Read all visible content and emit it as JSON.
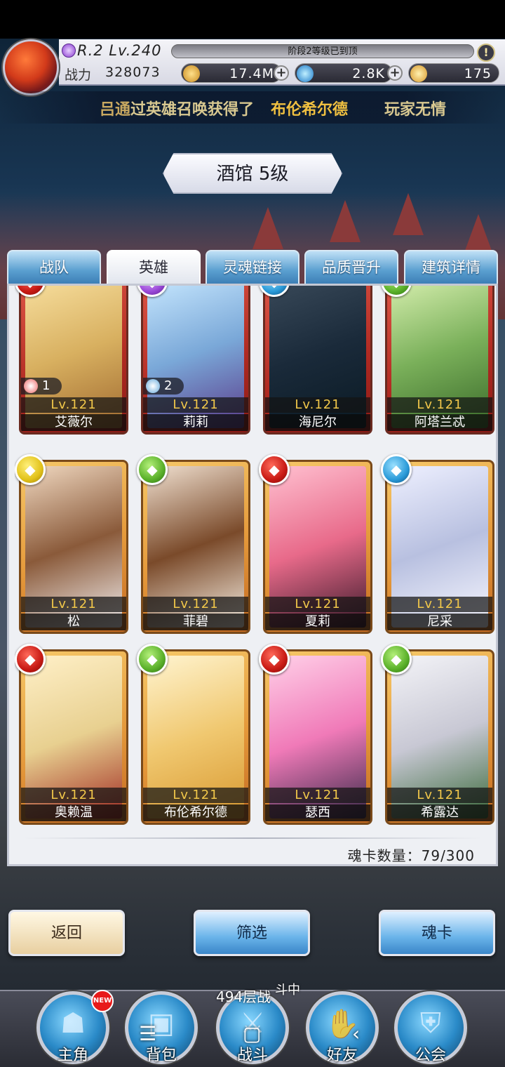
{
  "player": {
    "rank": "R.2 Lv.240",
    "stage_notice": "阶段2等级已到顶",
    "power_label": "战力",
    "power_value": "328073"
  },
  "resources": [
    {
      "icon": "gold-coin-icon",
      "value": "17.4M",
      "color": "#e0a030"
    },
    {
      "icon": "blue-gem-icon",
      "value": "2.8K",
      "color": "#2a8ad8"
    },
    {
      "icon": "gold-ticket-icon",
      "value": "175",
      "color": "#e8b040"
    }
  ],
  "marquee": {
    "part1": "过英雄召唤获得了",
    "hero": "布伦希尔德",
    "part2": "玩家无情",
    "prefix": "吕通"
  },
  "tavern": {
    "title": "酒馆 5级"
  },
  "tabs": [
    {
      "label": "战队"
    },
    {
      "label": "英雄",
      "active": true
    },
    {
      "label": "灵魂链接"
    },
    {
      "label": "品质晋升"
    },
    {
      "label": "建筑详情"
    }
  ],
  "heroes": [
    {
      "name": "艾薇尔",
      "level": "Lv.121",
      "soul": "1",
      "badge": "red",
      "frame": "red"
    },
    {
      "name": "莉莉",
      "level": "Lv.121",
      "soul": "2",
      "badge": "purple",
      "frame": "red"
    },
    {
      "name": "海尼尔",
      "level": "Lv.121",
      "badge": "blue",
      "frame": "red"
    },
    {
      "name": "阿塔兰忒",
      "level": "Lv.121",
      "badge": "green",
      "frame": "red"
    },
    {
      "name": "松",
      "level": "Lv.121",
      "badge": "yellow",
      "frame": "gold"
    },
    {
      "name": "菲碧",
      "level": "Lv.121",
      "badge": "green",
      "frame": "gold"
    },
    {
      "name": "夏莉",
      "level": "Lv.121",
      "badge": "red",
      "frame": "gold"
    },
    {
      "name": "尼采",
      "level": "Lv.121",
      "badge": "blue",
      "frame": "gold"
    },
    {
      "name": "奥赖温",
      "level": "Lv.121",
      "badge": "red",
      "frame": "gold"
    },
    {
      "name": "布伦希尔德",
      "level": "Lv.121",
      "badge": "green",
      "frame": "gold"
    },
    {
      "name": "瑟西",
      "level": "Lv.121",
      "badge": "red",
      "frame": "gold"
    },
    {
      "name": "希露达",
      "level": "Lv.121",
      "badge": "green",
      "frame": "gold"
    }
  ],
  "soul_card_count": "魂卡数量：79/300",
  "buttons": {
    "back": "返回",
    "filter": "筛选",
    "soulcard": "魂卡"
  },
  "nav": [
    {
      "label": "主角",
      "icon": "hero-helmet-icon"
    },
    {
      "label": "背包",
      "icon": "backpack-icon"
    },
    {
      "label": "战斗",
      "icon": "crossed-swords-icon"
    },
    {
      "label": "好友",
      "icon": "handshake-icon"
    },
    {
      "label": "公会",
      "icon": "guild-crest-icon"
    }
  ],
  "nav_new_badge": "NEW",
  "floor_text": "494层战",
  "floor_status": "斗中"
}
